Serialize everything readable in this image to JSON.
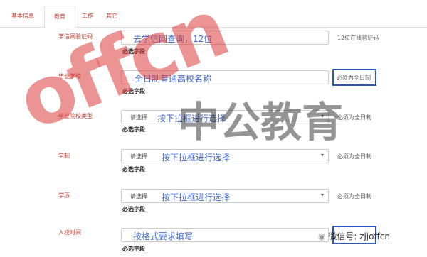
{
  "tabs": [
    "基本信息",
    "教育",
    "工作",
    "其它"
  ],
  "required_label": "必选字段",
  "rows": [
    {
      "label": "学信网验证码",
      "hint": "去学信网查询，12位",
      "note": "12位在线验证码",
      "selected": ""
    },
    {
      "label": "毕业学校",
      "hint": "全日制普通高校名称",
      "note": "必须为全日制",
      "selected": ""
    },
    {
      "label": "毕业院校类型",
      "hint": "按下拉框进行选择",
      "note": "必须为全日制",
      "selected": "请选择"
    },
    {
      "label": "学制",
      "hint": "按下拉框进行选择",
      "note": "必须为全日制",
      "selected": "请选择"
    },
    {
      "label": "学历",
      "hint": "按下拉框进行选择",
      "note": "必须为全日制",
      "selected": "请选择"
    },
    {
      "label": "入校时间",
      "hint": "按格式要求填写",
      "note": "",
      "selected": ""
    }
  ],
  "watermark": {
    "brand_latin": "offcn",
    "brand_cn": "中公教育"
  },
  "footer": {
    "wechat": "微信号: zjjoffcn"
  },
  "colors": {
    "label": "#c0392b",
    "hint": "#3f67c7",
    "highlight_box": "#2e57b8",
    "watermark_red": "#dc3c3c"
  }
}
